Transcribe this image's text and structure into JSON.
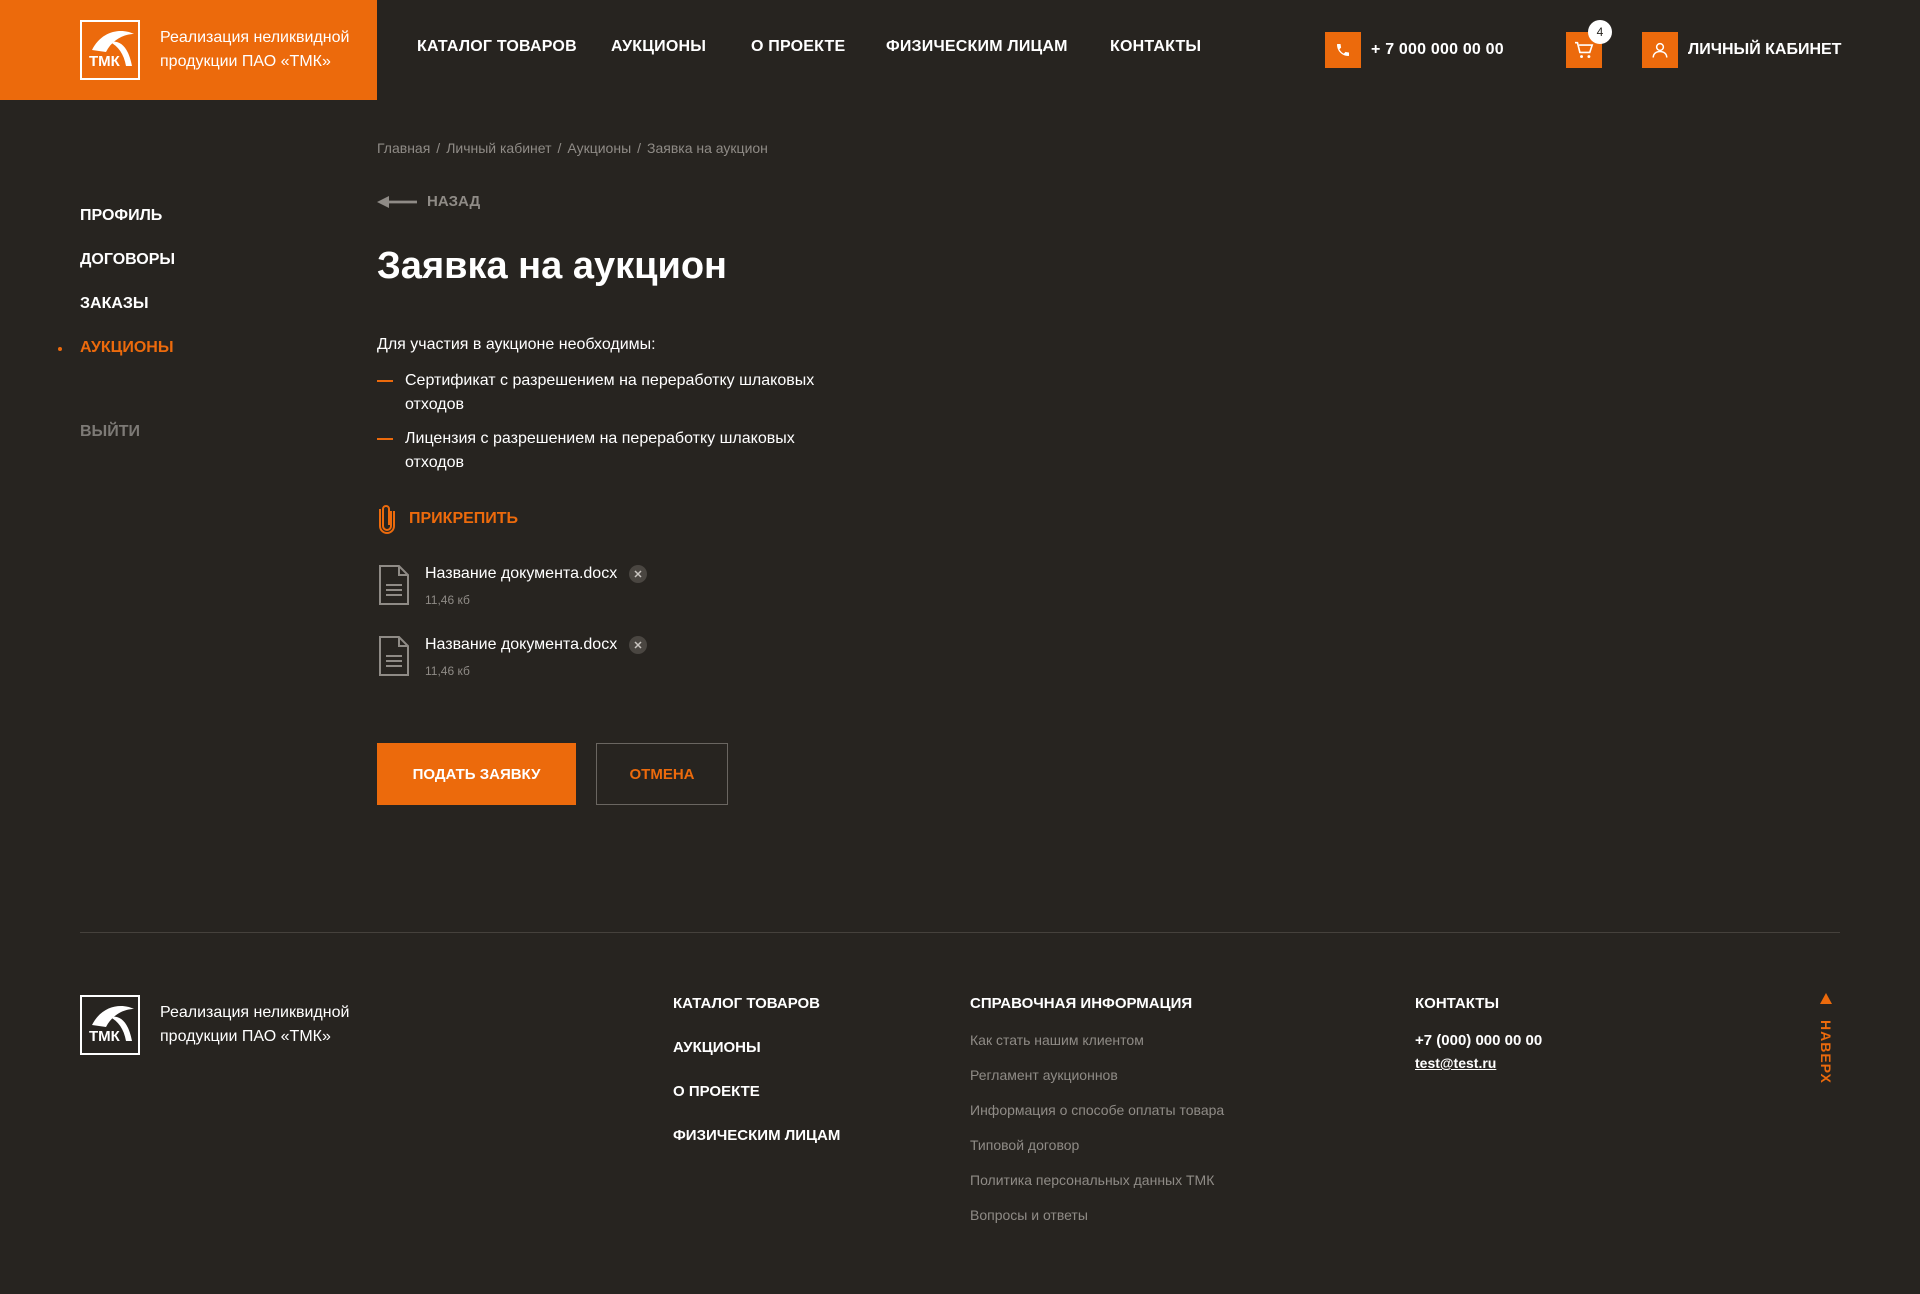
{
  "colors": {
    "accent": "#ec6a0c",
    "background": "#272420",
    "muted": "#8f8b86"
  },
  "header": {
    "brand_text_line1": "Реализация неликвидной",
    "brand_text_line2": "продукции ПАО «ТМК»",
    "logo_text": "ТМК",
    "nav": [
      "КАТАЛОГ ТОВАРОВ",
      "АУКЦИОНЫ",
      "О ПРОЕКТЕ",
      "ФИЗИЧЕСКИМ ЛИЦАМ",
      "КОНТАКТЫ"
    ],
    "phone": "+ 7 000 000 00 00",
    "cart_count": "4",
    "account_label": "ЛИЧНЫЙ КАБИНЕТ",
    "icons": {
      "phone": "phone-icon",
      "cart": "cart-icon",
      "account": "user-icon"
    }
  },
  "sidebar": {
    "items": [
      "ПРОФИЛЬ",
      "ДОГОВОРЫ",
      "ЗАКАЗЫ",
      "АУКЦИОНЫ"
    ],
    "active_index": 3,
    "logout": "ВЫЙТИ"
  },
  "breadcrumb": [
    "Главная",
    "Личный кабинет",
    "Аукционы",
    "Заявка на аукцион"
  ],
  "back_label": "НАЗАД",
  "page_title": "Заявка на аукцион",
  "requirements": {
    "intro": "Для участия в аукционе необходимы:",
    "items": [
      "Сертификат с разрешением на переработку шлаковых отходов",
      "Лицензия с разрешением на переработку шлаковых отходов"
    ]
  },
  "attach_label": "ПРИКРЕПИТЬ",
  "files": [
    {
      "name": "Название документа.docx",
      "size": "11,46 кб"
    },
    {
      "name": "Название документа.docx",
      "size": "11,46 кб"
    }
  ],
  "buttons": {
    "submit": "ПОДАТЬ ЗАЯВКУ",
    "cancel": "ОТМЕНА"
  },
  "footer": {
    "brand_text_line1": "Реализация неликвидной",
    "brand_text_line2": "продукции ПАО «ТМК»",
    "nav": [
      "КАТАЛОГ ТОВАРОВ",
      "АУКЦИОНЫ",
      "О ПРОЕКТЕ",
      "ФИЗИЧЕСКИМ ЛИЦАМ"
    ],
    "info_heading": "СПРАВОЧНАЯ ИНФОРМАЦИЯ",
    "info_links": [
      "Как стать нашим клиентом",
      "Регламент аукционнов",
      "Информация о способе оплаты товара",
      "Типовой договор",
      "Политика персональных данных ТМК",
      "Вопросы и ответы"
    ],
    "contacts_heading": "КОНТАКТЫ",
    "phone": "+7 (000) 000 00 00",
    "email": "test@test.ru",
    "to_top": "НАВЕРХ"
  }
}
